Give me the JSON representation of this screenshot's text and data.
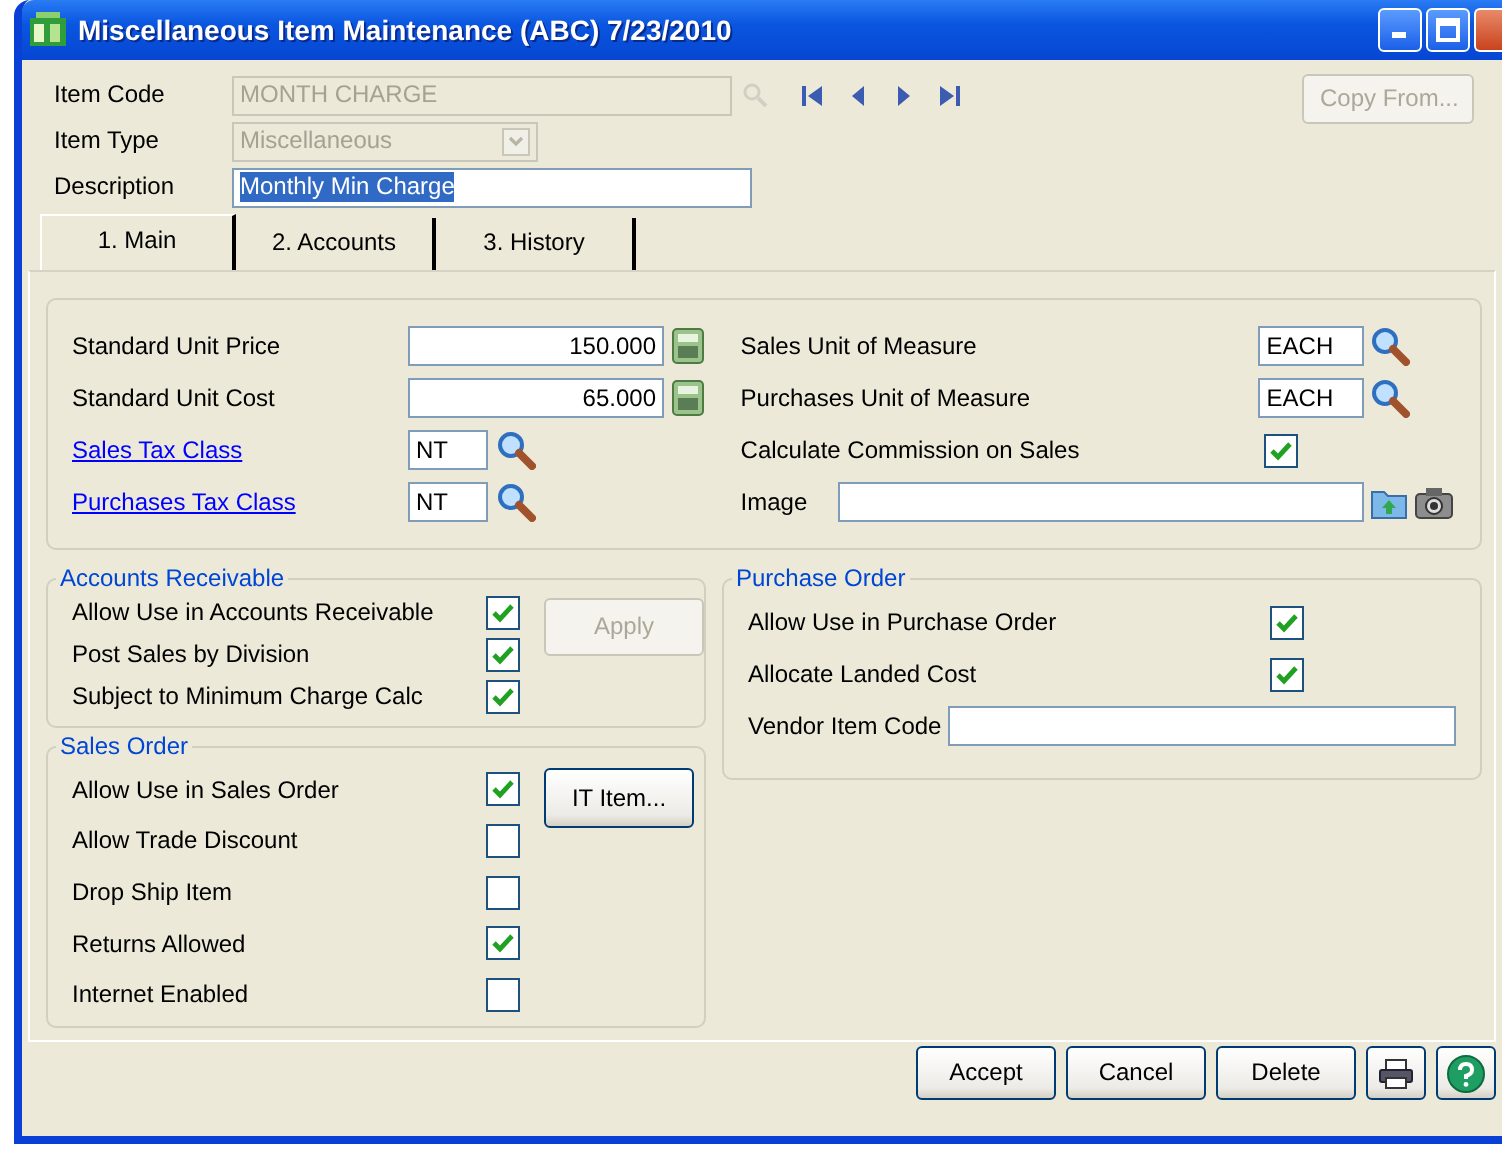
{
  "window": {
    "title": "Miscellaneous Item Maintenance (ABC) 7/23/2010"
  },
  "header": {
    "fields": [
      {
        "label": "Item Code",
        "value": "MONTH CHARGE",
        "kind": "text",
        "disabled": true,
        "selected_text": false
      },
      {
        "label": "Item Type",
        "value": "Miscellaneous",
        "kind": "dropdown",
        "disabled": true,
        "selected_text": false
      },
      {
        "label": "Description",
        "value": "Monthly Min Charge",
        "kind": "text",
        "disabled": false,
        "selected_text": true
      }
    ],
    "copy_button": {
      "label": "Copy From...",
      "disabled": true
    }
  },
  "tabs": [
    {
      "label": "1. Main",
      "selected": true
    },
    {
      "label": "2. Accounts",
      "selected": false
    },
    {
      "label": "3. History",
      "selected": false
    }
  ],
  "main": {
    "left_fields": [
      {
        "label": "Standard Unit Price",
        "value": "150.000",
        "kind": "calculator",
        "link": false
      },
      {
        "label": "Standard Unit Cost",
        "value": "65.000",
        "kind": "calculator",
        "link": false
      },
      {
        "label": "Sales Tax Class",
        "value": "NT",
        "kind": "lookup",
        "link": true
      },
      {
        "label": "Purchases Tax Class",
        "value": "NT",
        "kind": "lookup",
        "link": true
      }
    ],
    "right_fields": [
      {
        "label": "Sales Unit of Measure",
        "value": "EACH",
        "kind": "lookup"
      },
      {
        "label": "Purchases Unit of Measure",
        "value": "EACH",
        "kind": "lookup"
      },
      {
        "label": "Calculate Commission on Sales",
        "kind": "checkbox",
        "checked": true
      },
      {
        "label": "Image",
        "kind": "image"
      }
    ]
  },
  "accounts_receivable": {
    "title": "Accounts Receivable",
    "options": [
      {
        "label": "Allow Use in Accounts Receivable",
        "checked": true
      },
      {
        "label": "Post Sales by Division",
        "checked": true
      },
      {
        "label": "Subject to Minimum Charge Calc",
        "checked": true
      }
    ],
    "apply_button": {
      "label": "Apply",
      "disabled": true
    }
  },
  "sales_order": {
    "title": "Sales Order",
    "options": [
      {
        "label": "Allow Use in Sales Order",
        "checked": true
      },
      {
        "label": "Allow Trade Discount",
        "checked": false
      },
      {
        "label": "Drop Ship Item",
        "checked": false
      },
      {
        "label": "Returns Allowed",
        "checked": true
      },
      {
        "label": "Internet Enabled",
        "checked": false
      }
    ],
    "it_item_button": {
      "label": "IT Item...",
      "disabled": false
    }
  },
  "purchase_order": {
    "title": "Purchase Order",
    "options": [
      {
        "label": "Allow Use in Purchase Order",
        "checked": true
      },
      {
        "label": "Allocate Landed Cost",
        "checked": true
      }
    ],
    "vendor_item_code": {
      "label": "Vendor Item Code"
    }
  },
  "buttons": [
    {
      "label": "Accept",
      "disabled": false
    },
    {
      "label": "Cancel",
      "disabled": false
    },
    {
      "label": "Delete",
      "disabled": false
    }
  ]
}
